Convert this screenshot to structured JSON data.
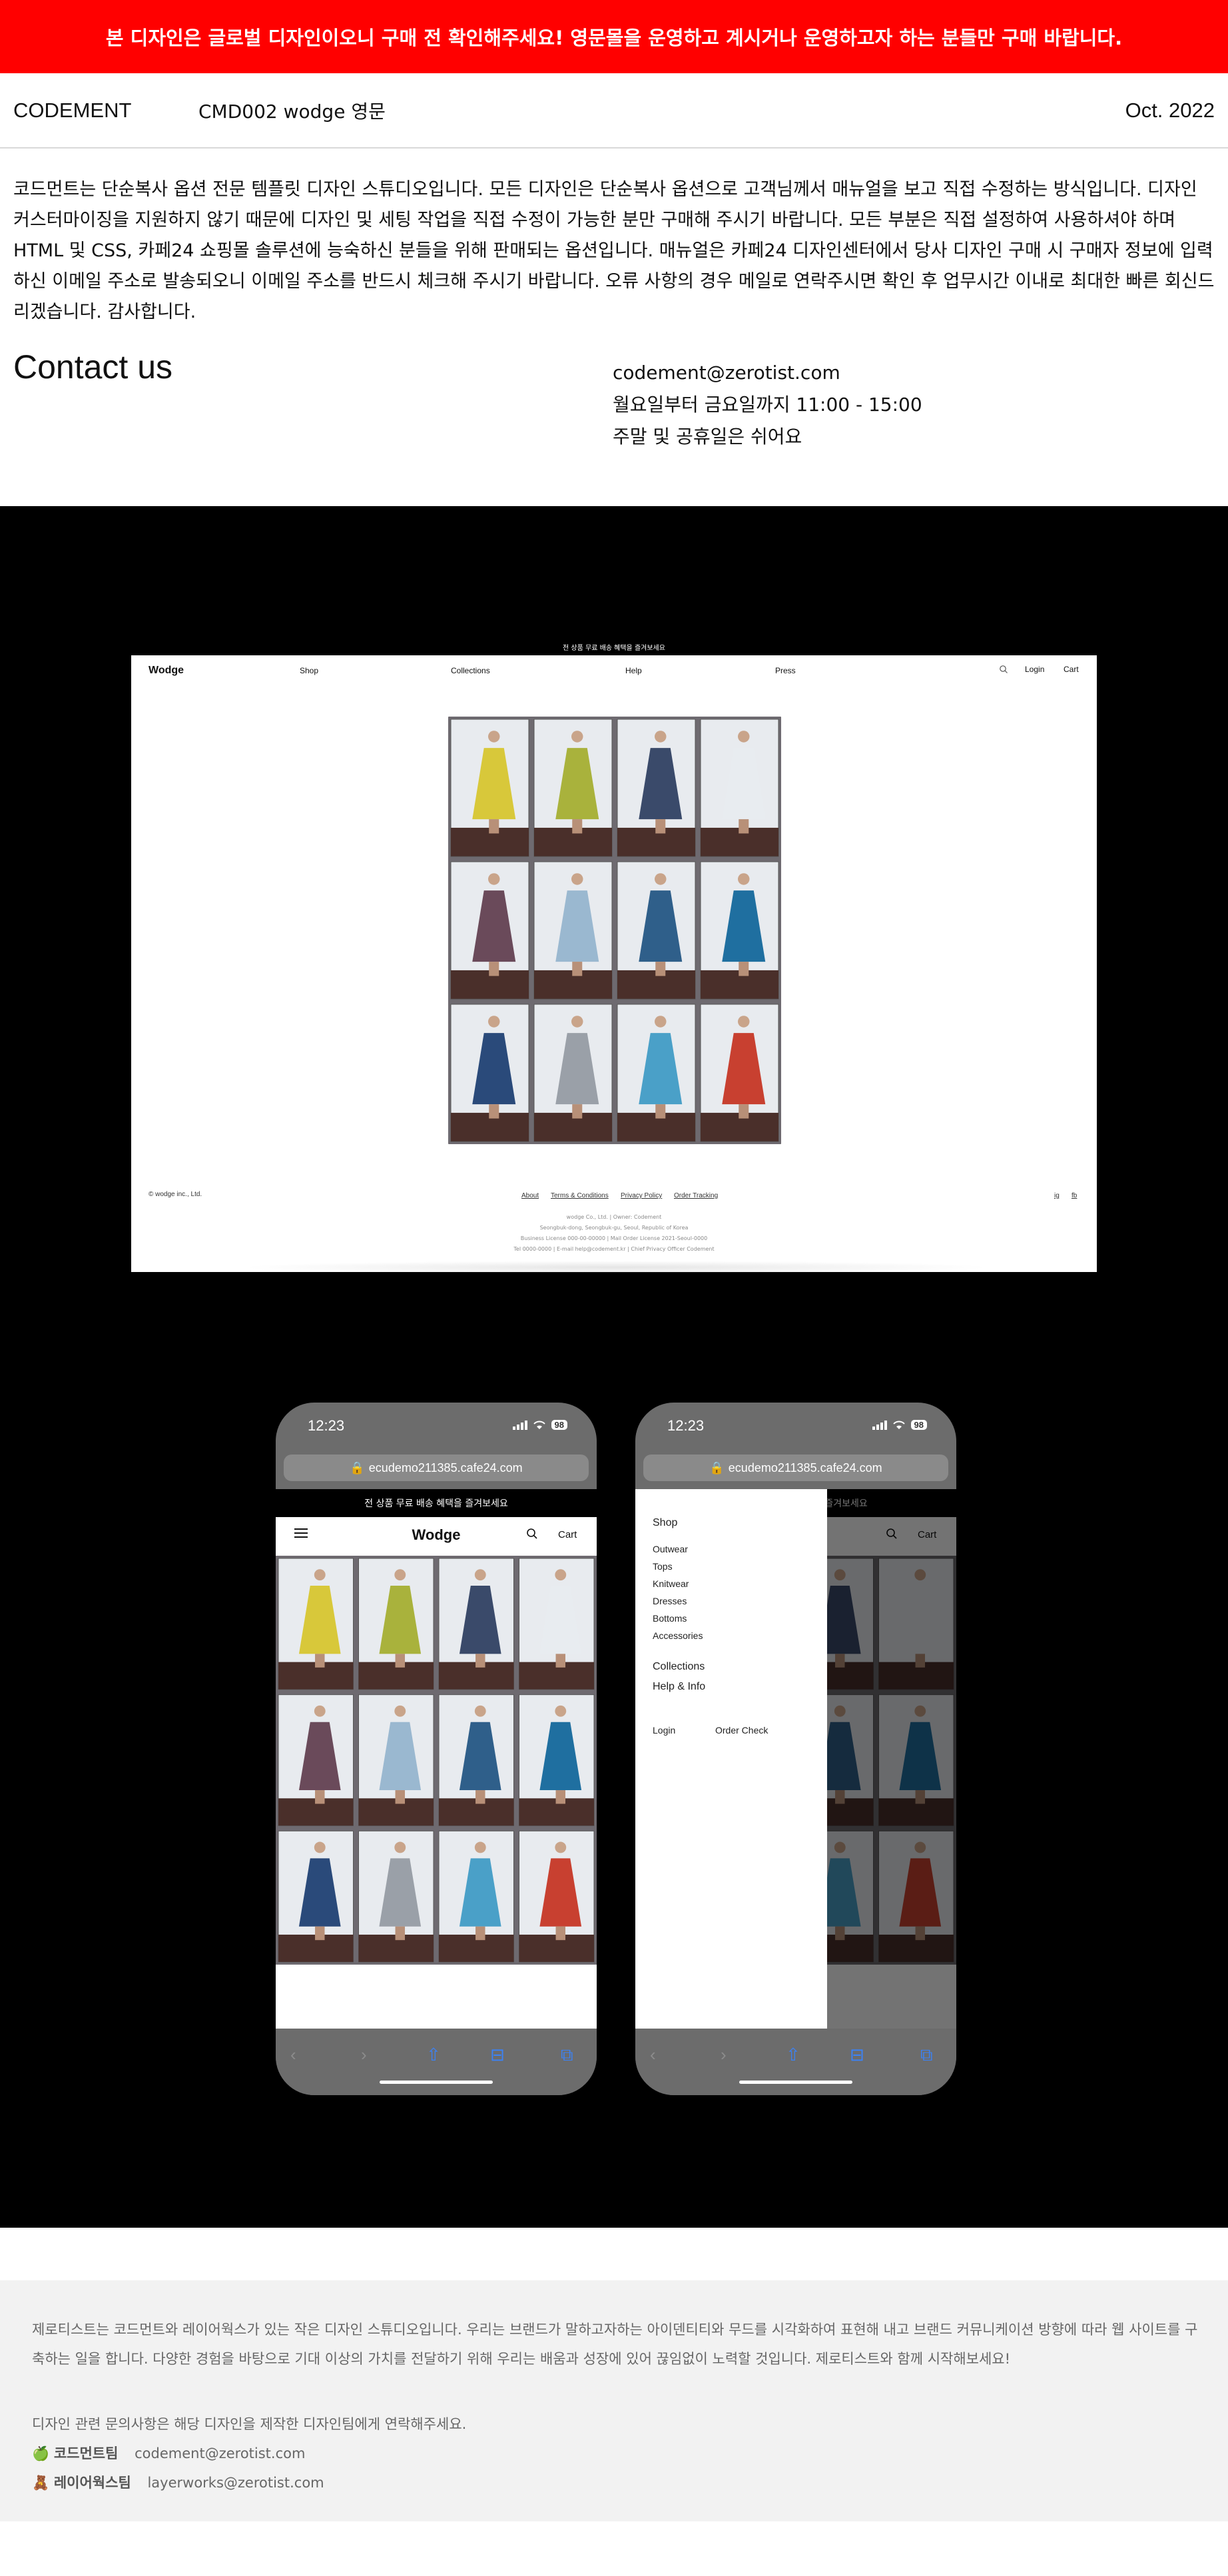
{
  "banner": {
    "text": "본 디자인은 글로벌 디자인이오니 구매 전 확인해주세요! 영문몰을 운영하고 계시거나 운영하고자 하는 분들만 구매 바랍니다.",
    "bg_color": "#ff0000"
  },
  "infobar": {
    "brand": "CODEMENT",
    "code": "CMD002 wodge 영문",
    "date": "Oct. 2022"
  },
  "description": "코드먼트는 단순복사 옵션 전문 템플릿 디자인 스튜디오입니다. 모든 디자인은 단순복사 옵션으로 고객님께서 매뉴얼을 보고 직접 수정하는 방식입니다. 디자인 커스터마이징을 지원하지 않기 때문에 디자인 및 세팅 작업을 직접 수정이 가능한 분만 구매해 주시기 바랍니다. 모든 부분은 직접 설정하여 사용하셔야 하며 HTML 및 CSS, 카페24 쇼핑몰 솔루션에 능숙하신 분들을 위해 판매되는 옵션입니다. 매뉴얼은 카페24 디자인센터에서 당사 디자인 구매 시 구매자 정보에 입력하신 이메일 주소로 발송되오니 이메일 주소를 반드시 체크해 주시기 바랍니다. 오류 사항의 경우 메일로 연락주시면 확인 후 업무시간 이내로 최대한 빠른 회신드리겠습니다. 감사합니다.",
  "contact": {
    "title": "Contact us",
    "email": "codement@zerotist.com",
    "hours": "월요일부터 금요일까지 11:00 - 15:00",
    "closed": "주말 및 공휴일은 쉬어요"
  },
  "desktop": {
    "promo": "전 상품 무료 배송 혜택을 즐겨보세요",
    "logo": "Wodge",
    "nav": [
      "Shop",
      "Collections",
      "Help",
      "Press"
    ],
    "login": "Login",
    "cart": "Cart",
    "icons": {
      "search": "search-icon"
    },
    "footer": {
      "copyright": "© wodge inc., Ltd.",
      "links": [
        "About",
        "Terms & Conditions",
        "Privacy Policy",
        "Order Tracking"
      ],
      "social": [
        "ig",
        "fb"
      ],
      "info_lines": [
        "wodge Co., Ltd. | Owner: Codement",
        "Seongbuk-dong, Seongbuk-gu, Seoul, Republic of Korea",
        "Business License 000-00-00000 | Mail Order License 2021-Seoul-0000",
        "Tel 0000-0000 | E-mail help@codement.kr | Chief Privacy Officer Codement"
      ]
    }
  },
  "phones": {
    "time": "12:23",
    "battery": "98",
    "url": "ecudemo211385.cafe24.com",
    "promo": "전 상품 무료 배송 혜택을 즐겨보세요",
    "logo": "Wodge",
    "cart": "Cart",
    "drawer": {
      "shop": "Shop",
      "categories": [
        "Outwear",
        "Tops",
        "Knitwear",
        "Dresses",
        "Bottoms",
        "Accessories"
      ],
      "collections": "Collections",
      "help": "Help & Info",
      "login": "Login",
      "order_check": "Order Check"
    }
  },
  "footer": {
    "about": "제로티스트는 코드먼트와 레이어웍스가 있는 작은 디자인 스튜디오입니다. 우리는 브랜드가 말하고자하는 아이덴티티와 무드를 시각화하여 표현해 내고 브랜드 커뮤니케이션 방향에 따라 웹 사이트를 구축하는 일을 합니다. 다양한 경험을 바탕으로 기대 이상의 가치를 전달하기 위해 우리는 배움과 성장에 있어 끊임없이 노력할 것입니다. 제로티스트와 함께 시작해보세요!",
    "inquiry": "디자인 관련 문의사항은 해당 디자인을 제작한 디자인팀에게 연락해주세요.",
    "teams": [
      {
        "icon": "🍏",
        "name": "코드먼트팀",
        "email": "codement@zerotist.com"
      },
      {
        "icon": "🧸",
        "name": "레이어웍스팀",
        "email": "layerworks@zerotist.com"
      }
    ]
  }
}
